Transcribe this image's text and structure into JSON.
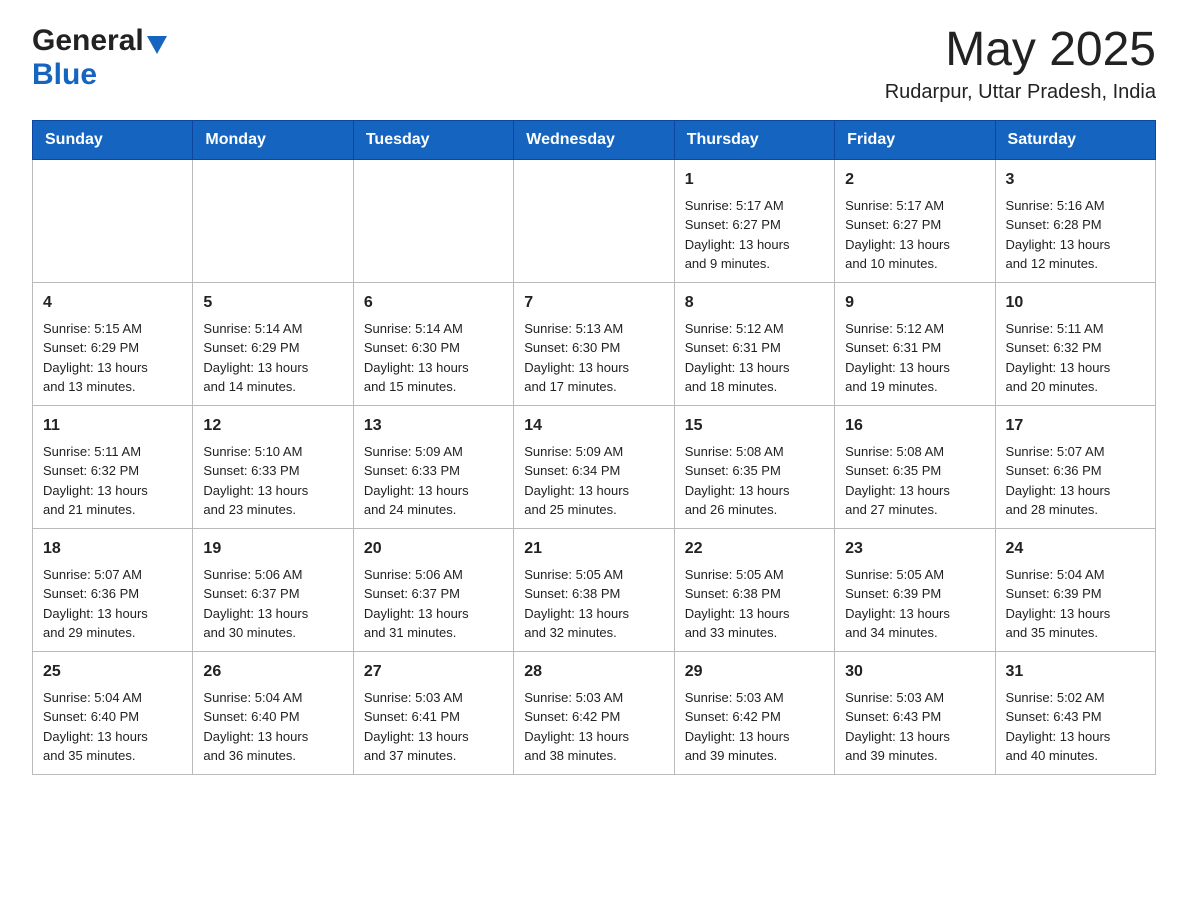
{
  "header": {
    "logo_general": "General",
    "logo_blue": "Blue",
    "month_year": "May 2025",
    "location": "Rudarpur, Uttar Pradesh, India"
  },
  "weekdays": [
    "Sunday",
    "Monday",
    "Tuesday",
    "Wednesday",
    "Thursday",
    "Friday",
    "Saturday"
  ],
  "weeks": [
    [
      {
        "day": "",
        "info": ""
      },
      {
        "day": "",
        "info": ""
      },
      {
        "day": "",
        "info": ""
      },
      {
        "day": "",
        "info": ""
      },
      {
        "day": "1",
        "info": "Sunrise: 5:17 AM\nSunset: 6:27 PM\nDaylight: 13 hours\nand 9 minutes."
      },
      {
        "day": "2",
        "info": "Sunrise: 5:17 AM\nSunset: 6:27 PM\nDaylight: 13 hours\nand 10 minutes."
      },
      {
        "day": "3",
        "info": "Sunrise: 5:16 AM\nSunset: 6:28 PM\nDaylight: 13 hours\nand 12 minutes."
      }
    ],
    [
      {
        "day": "4",
        "info": "Sunrise: 5:15 AM\nSunset: 6:29 PM\nDaylight: 13 hours\nand 13 minutes."
      },
      {
        "day": "5",
        "info": "Sunrise: 5:14 AM\nSunset: 6:29 PM\nDaylight: 13 hours\nand 14 minutes."
      },
      {
        "day": "6",
        "info": "Sunrise: 5:14 AM\nSunset: 6:30 PM\nDaylight: 13 hours\nand 15 minutes."
      },
      {
        "day": "7",
        "info": "Sunrise: 5:13 AM\nSunset: 6:30 PM\nDaylight: 13 hours\nand 17 minutes."
      },
      {
        "day": "8",
        "info": "Sunrise: 5:12 AM\nSunset: 6:31 PM\nDaylight: 13 hours\nand 18 minutes."
      },
      {
        "day": "9",
        "info": "Sunrise: 5:12 AM\nSunset: 6:31 PM\nDaylight: 13 hours\nand 19 minutes."
      },
      {
        "day": "10",
        "info": "Sunrise: 5:11 AM\nSunset: 6:32 PM\nDaylight: 13 hours\nand 20 minutes."
      }
    ],
    [
      {
        "day": "11",
        "info": "Sunrise: 5:11 AM\nSunset: 6:32 PM\nDaylight: 13 hours\nand 21 minutes."
      },
      {
        "day": "12",
        "info": "Sunrise: 5:10 AM\nSunset: 6:33 PM\nDaylight: 13 hours\nand 23 minutes."
      },
      {
        "day": "13",
        "info": "Sunrise: 5:09 AM\nSunset: 6:33 PM\nDaylight: 13 hours\nand 24 minutes."
      },
      {
        "day": "14",
        "info": "Sunrise: 5:09 AM\nSunset: 6:34 PM\nDaylight: 13 hours\nand 25 minutes."
      },
      {
        "day": "15",
        "info": "Sunrise: 5:08 AM\nSunset: 6:35 PM\nDaylight: 13 hours\nand 26 minutes."
      },
      {
        "day": "16",
        "info": "Sunrise: 5:08 AM\nSunset: 6:35 PM\nDaylight: 13 hours\nand 27 minutes."
      },
      {
        "day": "17",
        "info": "Sunrise: 5:07 AM\nSunset: 6:36 PM\nDaylight: 13 hours\nand 28 minutes."
      }
    ],
    [
      {
        "day": "18",
        "info": "Sunrise: 5:07 AM\nSunset: 6:36 PM\nDaylight: 13 hours\nand 29 minutes."
      },
      {
        "day": "19",
        "info": "Sunrise: 5:06 AM\nSunset: 6:37 PM\nDaylight: 13 hours\nand 30 minutes."
      },
      {
        "day": "20",
        "info": "Sunrise: 5:06 AM\nSunset: 6:37 PM\nDaylight: 13 hours\nand 31 minutes."
      },
      {
        "day": "21",
        "info": "Sunrise: 5:05 AM\nSunset: 6:38 PM\nDaylight: 13 hours\nand 32 minutes."
      },
      {
        "day": "22",
        "info": "Sunrise: 5:05 AM\nSunset: 6:38 PM\nDaylight: 13 hours\nand 33 minutes."
      },
      {
        "day": "23",
        "info": "Sunrise: 5:05 AM\nSunset: 6:39 PM\nDaylight: 13 hours\nand 34 minutes."
      },
      {
        "day": "24",
        "info": "Sunrise: 5:04 AM\nSunset: 6:39 PM\nDaylight: 13 hours\nand 35 minutes."
      }
    ],
    [
      {
        "day": "25",
        "info": "Sunrise: 5:04 AM\nSunset: 6:40 PM\nDaylight: 13 hours\nand 35 minutes."
      },
      {
        "day": "26",
        "info": "Sunrise: 5:04 AM\nSunset: 6:40 PM\nDaylight: 13 hours\nand 36 minutes."
      },
      {
        "day": "27",
        "info": "Sunrise: 5:03 AM\nSunset: 6:41 PM\nDaylight: 13 hours\nand 37 minutes."
      },
      {
        "day": "28",
        "info": "Sunrise: 5:03 AM\nSunset: 6:42 PM\nDaylight: 13 hours\nand 38 minutes."
      },
      {
        "day": "29",
        "info": "Sunrise: 5:03 AM\nSunset: 6:42 PM\nDaylight: 13 hours\nand 39 minutes."
      },
      {
        "day": "30",
        "info": "Sunrise: 5:03 AM\nSunset: 6:43 PM\nDaylight: 13 hours\nand 39 minutes."
      },
      {
        "day": "31",
        "info": "Sunrise: 5:02 AM\nSunset: 6:43 PM\nDaylight: 13 hours\nand 40 minutes."
      }
    ]
  ]
}
